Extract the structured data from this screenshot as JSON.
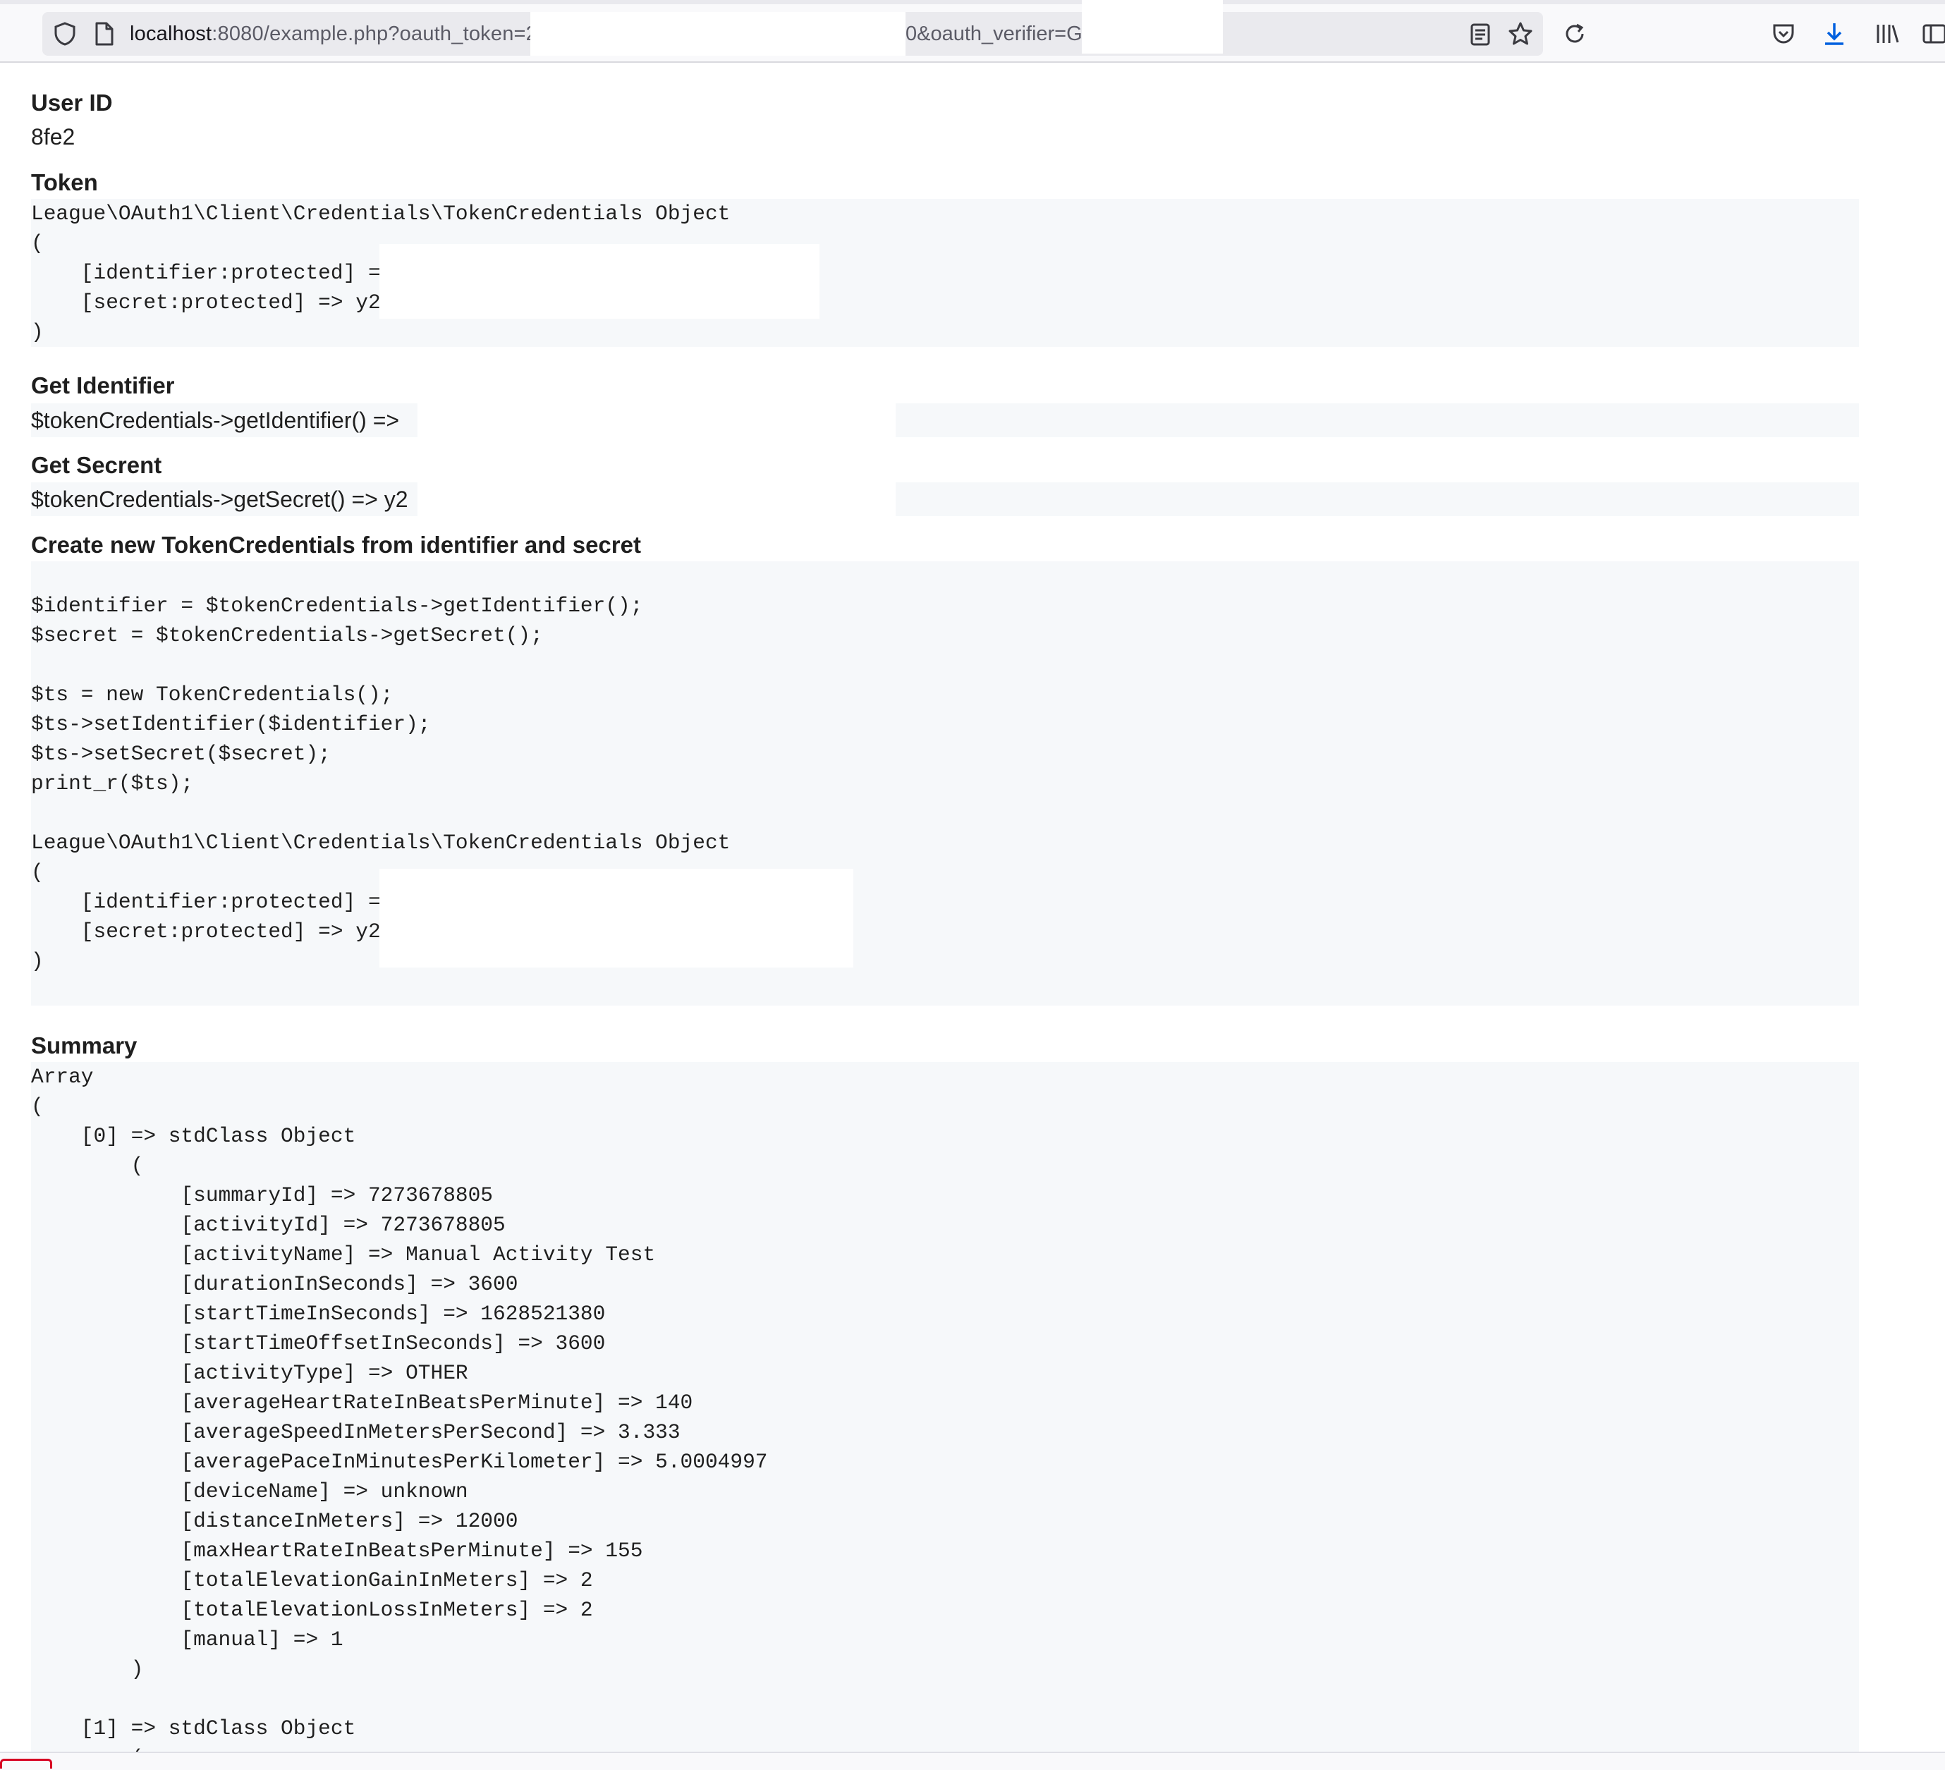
{
  "browser": {
    "url_host": "localhost",
    "url_rest": ":8080/example.php?oauth_token=2",
    "url_tail": "0&oauth_verifier=G",
    "icons": [
      "shield-icon",
      "page-icon",
      "reader-view-icon",
      "bookmark-star-icon",
      "reload-icon",
      "pocket-icon",
      "download-icon",
      "library-icon",
      "sidebar-icon"
    ]
  },
  "sections": {
    "user_id": {
      "heading": "User ID",
      "value": "8fe2"
    },
    "token": {
      "heading": "Token",
      "dump": "League\\OAuth1\\Client\\Credentials\\TokenCredentials Object\n(\n    [identifier:protected] => \n    [secret:protected] => y24l\n)"
    },
    "get_identifier": {
      "heading": "Get Identifier",
      "code": "$tokenCredentials->getIdentifier() =>"
    },
    "get_secret": {
      "heading": "Get Secrent",
      "code": "$tokenCredentials->getSecret() => y2"
    },
    "create": {
      "heading": "Create new TokenCredentials from identifier and secret",
      "code": "\n$identifier = $tokenCredentials->getIdentifier();\n$secret = $tokenCredentials->getSecret();\n\n$ts = new TokenCredentials();\n$ts->setIdentifier($identifier);\n$ts->setSecret($secret);\nprint_r($ts);\n\nLeague\\OAuth1\\Client\\Credentials\\TokenCredentials Object\n(\n    [identifier:protected] => \n    [secret:protected] => y24l\n)\n"
    },
    "summary": {
      "heading": "Summary",
      "dump": "Array\n(\n    [0] => stdClass Object\n        (\n            [summaryId] => 7273678805\n            [activityId] => 7273678805\n            [activityName] => Manual Activity Test\n            [durationInSeconds] => 3600\n            [startTimeInSeconds] => 1628521380\n            [startTimeOffsetInSeconds] => 3600\n            [activityType] => OTHER\n            [averageHeartRateInBeatsPerMinute] => 140\n            [averageSpeedInMetersPerSecond] => 3.333\n            [averagePaceInMinutesPerKilometer] => 5.0004997\n            [deviceName] => unknown\n            [distanceInMeters] => 12000\n            [maxHeartRateInBeatsPerMinute] => 155\n            [totalElevationGainInMeters] => 2\n            [totalElevationLossInMeters] => 2\n            [manual] => 1\n        )\n\n    [1] => stdClass Object\n        ("
    }
  }
}
